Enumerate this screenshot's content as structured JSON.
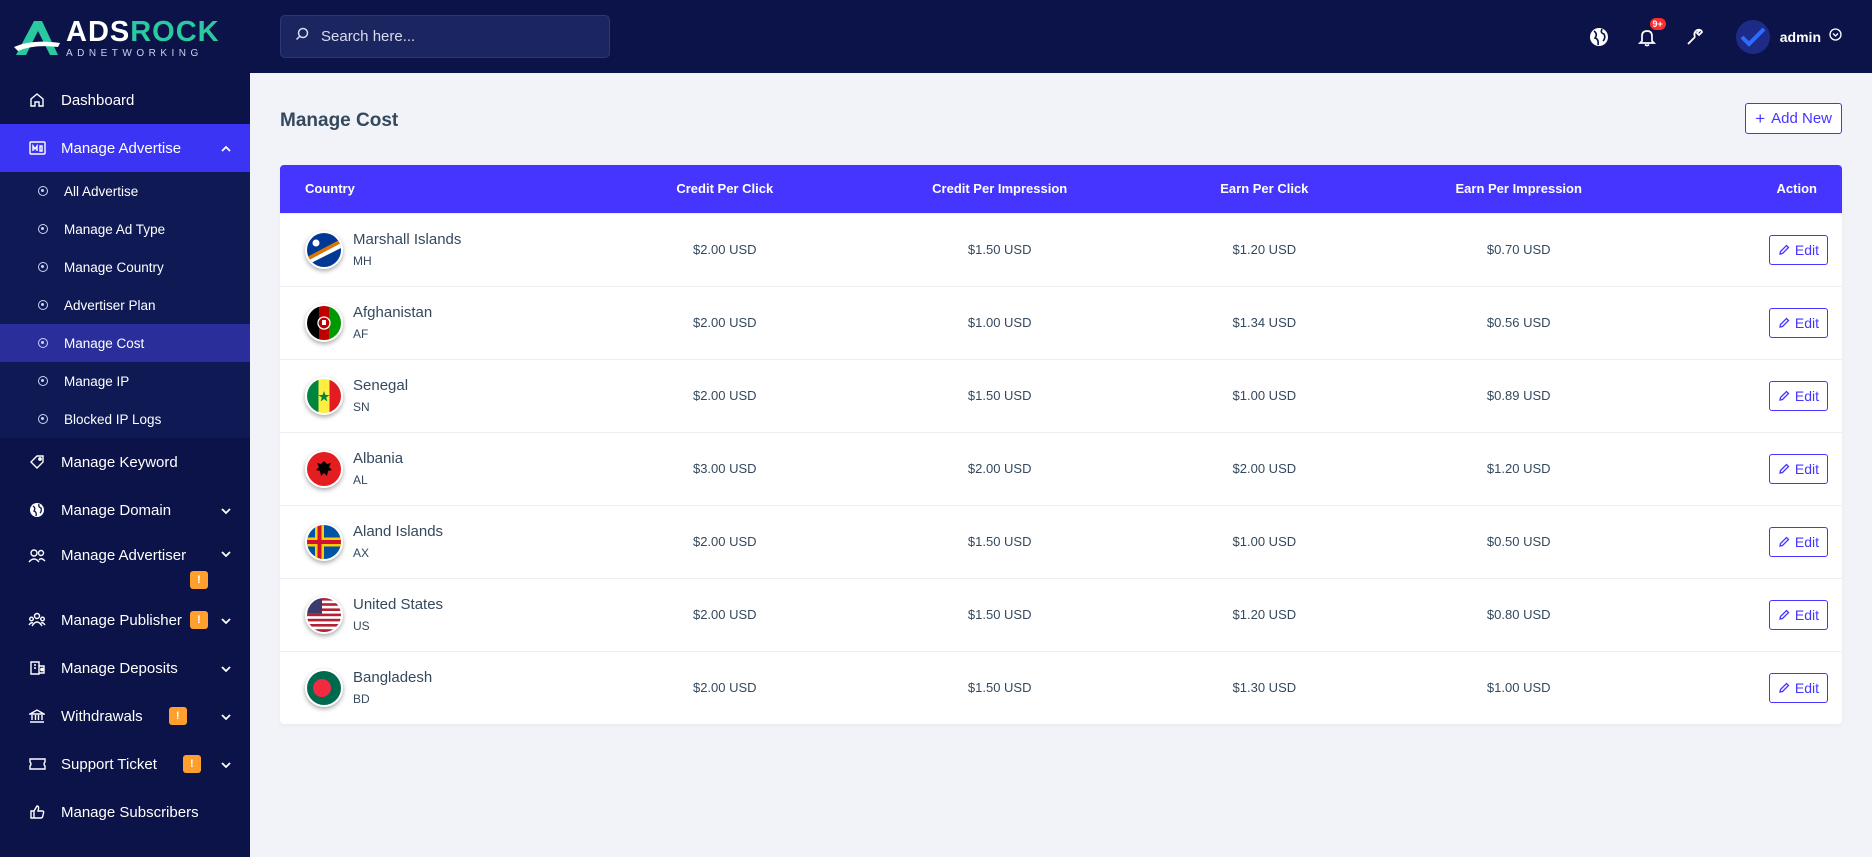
{
  "brand": {
    "name_part1": "ADS",
    "name_part2": "ROCK",
    "tagline": "ADNETWORKING"
  },
  "search": {
    "placeholder": "Search here..."
  },
  "header": {
    "notification_count": "9+",
    "username": "admin"
  },
  "sidebar": {
    "items": [
      {
        "label": "Dashboard",
        "icon": "home-icon"
      },
      {
        "label": "Manage Advertise",
        "icon": "advertise-icon",
        "expanded": true
      },
      {
        "label": "Manage Keyword",
        "icon": "tag-icon"
      },
      {
        "label": "Manage Domain",
        "icon": "globe-icon"
      },
      {
        "label": "Manage Advertiser",
        "icon": "users-icon",
        "badge": "!"
      },
      {
        "label": "Manage Publisher",
        "icon": "publisher-icon",
        "badge": "!"
      },
      {
        "label": "Manage Deposits",
        "icon": "deposit-icon"
      },
      {
        "label": "Withdrawals",
        "icon": "bank-icon",
        "badge": "!"
      },
      {
        "label": "Support Ticket",
        "icon": "ticket-icon",
        "badge": "!"
      },
      {
        "label": "Manage Subscribers",
        "icon": "thumbs-up-icon"
      }
    ],
    "subitems": [
      {
        "label": "All Advertise"
      },
      {
        "label": "Manage Ad Type"
      },
      {
        "label": "Manage Country"
      },
      {
        "label": "Advertiser Plan"
      },
      {
        "label": "Manage Cost",
        "active": true
      },
      {
        "label": "Manage IP"
      },
      {
        "label": "Blocked IP Logs"
      }
    ]
  },
  "main": {
    "title": "Manage Cost",
    "add_button": "Add New",
    "columns": [
      "Country",
      "Credit Per Click",
      "Credit Per Impression",
      "Earn Per Click",
      "Earn Per Impression",
      "Action"
    ],
    "edit_label": "Edit",
    "rows": [
      {
        "name": "Marshall Islands",
        "code": "MH",
        "cpc": "$2.00 USD",
        "cpi": "$1.50 USD",
        "epc": "$1.20 USD",
        "epi": "$0.70 USD"
      },
      {
        "name": "Afghanistan",
        "code": "AF",
        "cpc": "$2.00 USD",
        "cpi": "$1.00 USD",
        "epc": "$1.34 USD",
        "epi": "$0.56 USD"
      },
      {
        "name": "Senegal",
        "code": "SN",
        "cpc": "$2.00 USD",
        "cpi": "$1.50 USD",
        "epc": "$1.00 USD",
        "epi": "$0.89 USD"
      },
      {
        "name": "Albania",
        "code": "AL",
        "cpc": "$3.00 USD",
        "cpi": "$2.00 USD",
        "epc": "$2.00 USD",
        "epi": "$1.20 USD"
      },
      {
        "name": "Aland Islands",
        "code": "AX",
        "cpc": "$2.00 USD",
        "cpi": "$1.50 USD",
        "epc": "$1.00 USD",
        "epi": "$0.50 USD"
      },
      {
        "name": "United States",
        "code": "US",
        "cpc": "$2.00 USD",
        "cpi": "$1.50 USD",
        "epc": "$1.20 USD",
        "epi": "$0.80 USD"
      },
      {
        "name": "Bangladesh",
        "code": "BD",
        "cpc": "$2.00 USD",
        "cpi": "$1.50 USD",
        "epc": "$1.30 USD",
        "epi": "$1.00 USD"
      }
    ]
  },
  "colors": {
    "sidebar_bg": "#0b1348",
    "accent": "#4634ff",
    "brand_green": "#2bc9a0",
    "warn": "#ff9f2e",
    "danger": "#ff2d2d"
  }
}
